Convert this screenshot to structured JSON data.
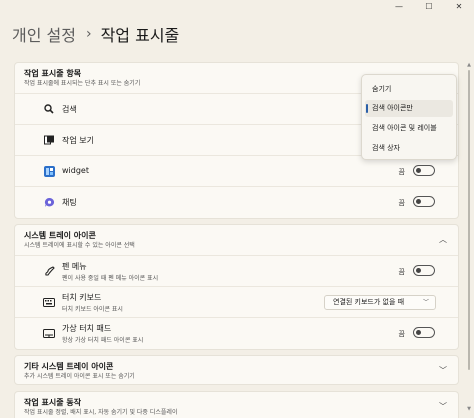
{
  "window": {
    "minimize": "—",
    "maximize": "☐",
    "close": "✕"
  },
  "breadcrumb": {
    "parent": "개인 설정",
    "separator": "›",
    "current": "작업 표시줄"
  },
  "taskbar_items": {
    "title": "작업 표시줄 항목",
    "subtitle": "작업 표시줄에 표시되는 단추 표시 또는 숨기기",
    "rows": [
      {
        "label": "검색"
      },
      {
        "label": "작업 보기"
      },
      {
        "label": "widget",
        "state": "끔"
      },
      {
        "label": "채팅",
        "state": "끔"
      }
    ],
    "search_options": [
      "숨기기",
      "검색 아이콘만",
      "검색 아이콘 및 레이블",
      "검색 상자"
    ]
  },
  "tray_icons": {
    "title": "시스템 트레이 아이콘",
    "subtitle": "시스템 트레이에 표시할 수 있는 아이콘 선택",
    "rows": [
      {
        "label": "펜 메뉴",
        "desc": "펜이 사용 중일 때 펜 메뉴 아이콘 표시",
        "state": "끔"
      },
      {
        "label": "터치 키보드",
        "desc": "터치 키보드 아이콘 표시",
        "select_value": "연결된 키보드가 없을 때"
      },
      {
        "label": "가상 터치 패드",
        "desc": "항상 가상 터치 패드 아이콘 표시",
        "state": "끔"
      }
    ]
  },
  "other_tray": {
    "title": "기타 시스템 트레이 아이콘",
    "subtitle": "추가 시스템 트레이 아이콘 표시 또는 숨기기"
  },
  "behaviors": {
    "title": "작업 표시줄 동작",
    "subtitle": "작업 표시줄 정렬, 배지 표시, 자동 숨기기 및 다중 디스플레이"
  },
  "icons": {
    "search": "search-icon",
    "taskview": "task-view-icon",
    "widget": "widget-icon",
    "chat": "chat-icon",
    "pen": "pen-icon",
    "keyboard": "keyboard-icon",
    "touchpad": "touchpad-icon"
  },
  "colors": {
    "accent": "#2a5fa8",
    "chat": "#6b63d9",
    "widget": "#2b6fc9"
  }
}
